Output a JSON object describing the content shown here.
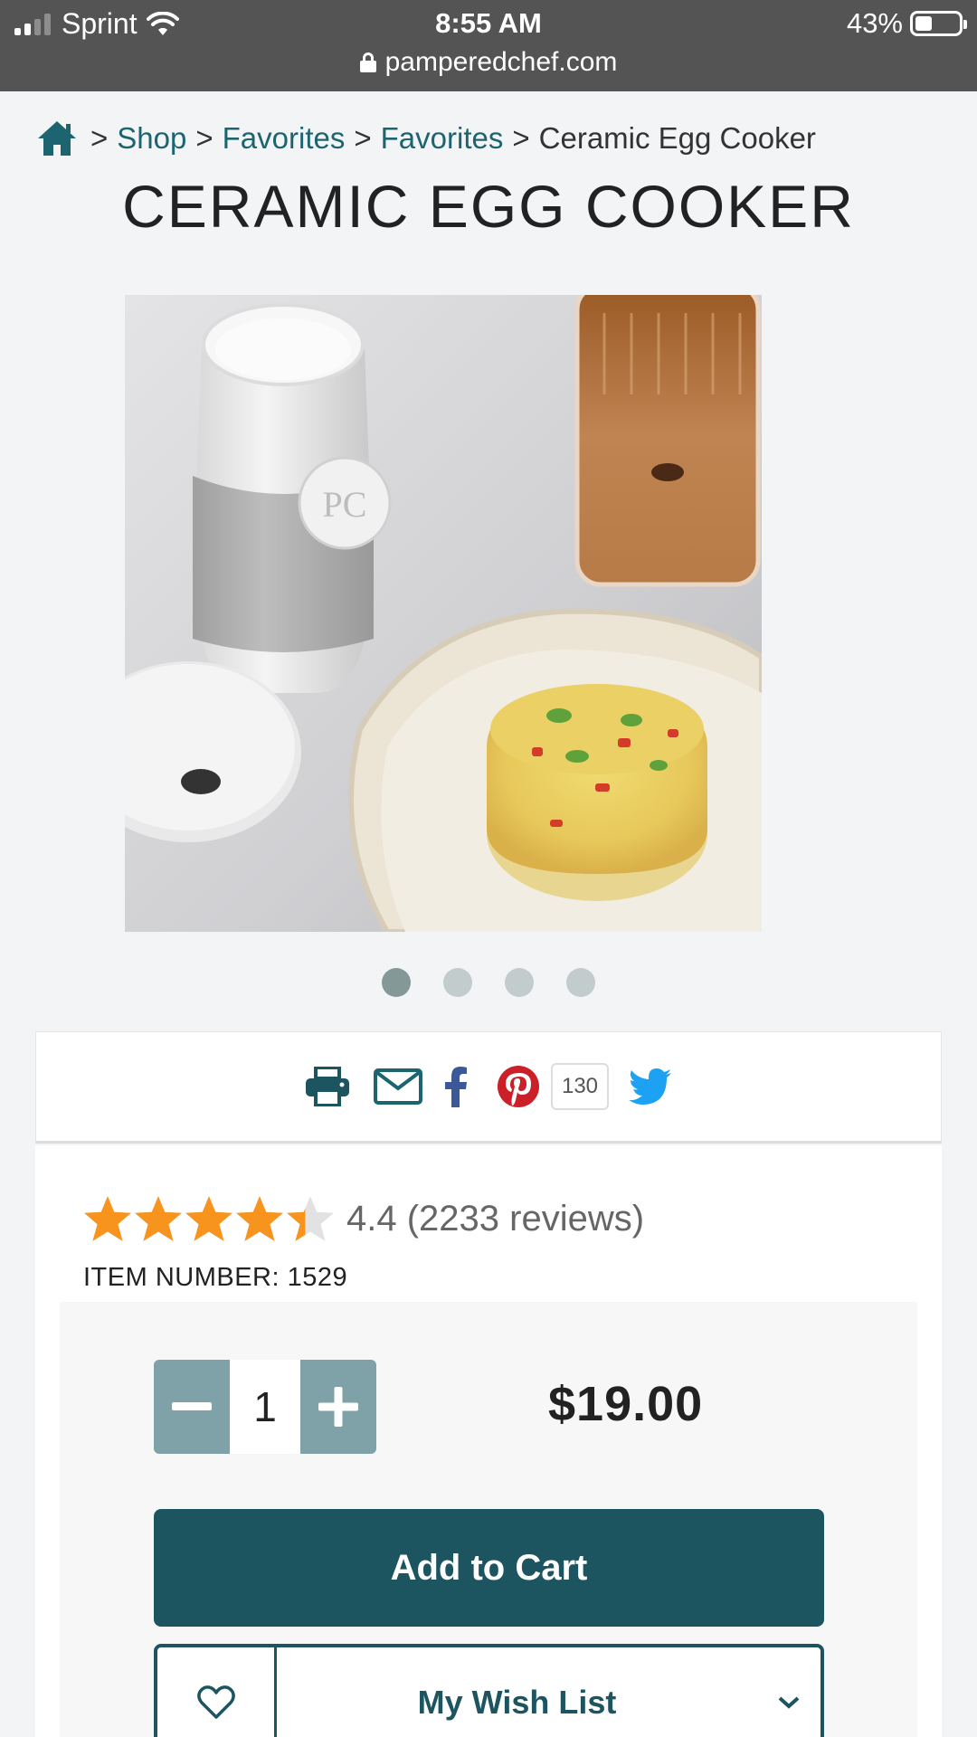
{
  "status_bar": {
    "carrier": "Sprint",
    "time": "8:55 AM",
    "battery": "43%",
    "url": "pamperedchef.com"
  },
  "breadcrumb": {
    "items": [
      "Shop",
      "Favorites",
      "Favorites"
    ],
    "current": "Ceramic Egg Cooker",
    "separator": ">"
  },
  "product": {
    "title": "CERAMIC EGG COOKER",
    "rating_value": 4.4,
    "rating_text": "4.4 (2233 reviews)",
    "item_number_label": "ITEM NUMBER: 1529",
    "price": "$19.00",
    "quantity": "1",
    "image_count": 4,
    "active_image_index": 0
  },
  "share": {
    "pinterest_count": "130",
    "icons": [
      "print-icon",
      "email-icon",
      "facebook-icon",
      "pinterest-icon",
      "twitter-icon"
    ]
  },
  "actions": {
    "add_to_cart": "Add to Cart",
    "wish_list": "My Wish List"
  },
  "colors": {
    "brand": "#1c5560",
    "link": "#1c6470",
    "star": "#f7941d",
    "stepper": "#7fa2a8"
  }
}
